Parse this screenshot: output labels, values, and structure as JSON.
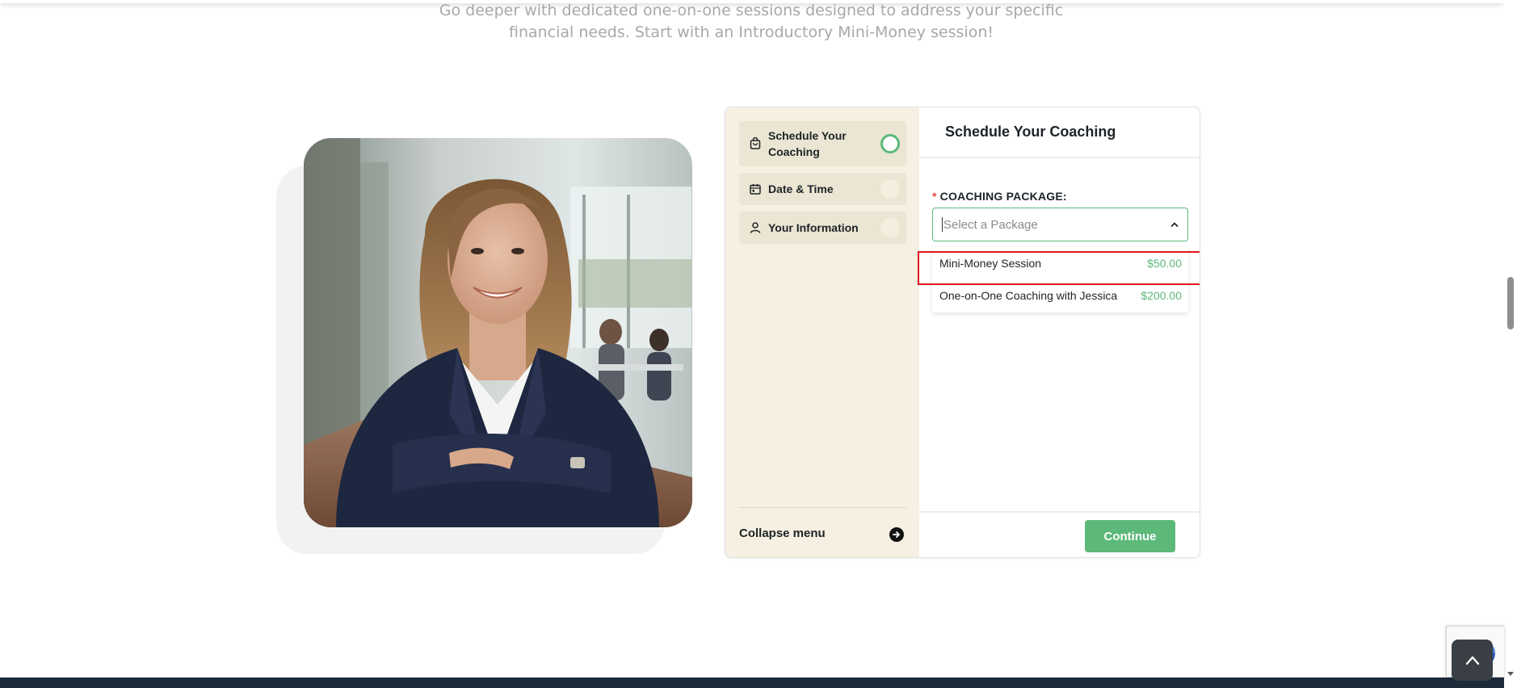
{
  "intro": {
    "line1": "Go deeper with dedicated one-on-one sessions designed to address your specific",
    "line2": "financial needs. Start with an Introductory Mini-Money session!"
  },
  "sidebar": {
    "steps": [
      {
        "label_line1": "Schedule Your",
        "label_line2": "Coaching",
        "icon": "bag-icon",
        "active": true
      },
      {
        "label": "Date & Time",
        "icon": "calendar-icon",
        "active": false
      },
      {
        "label": "Your Information",
        "icon": "user-icon",
        "active": false
      }
    ],
    "collapse_label": "Collapse menu"
  },
  "main": {
    "title": "Schedule Your Coaching",
    "field_label": "COACHING PACKAGE:",
    "required_mark": "*",
    "select_placeholder": "Select a Package",
    "options": [
      {
        "name": "Mini-Money Session",
        "price": "$50.00",
        "highlighted": true
      },
      {
        "name": "One-on-One Coaching with Jessica",
        "price": "$200.00",
        "highlighted": false
      }
    ],
    "continue_label": "Continue"
  },
  "colors": {
    "accent": "#5cb97a",
    "sidebar_bg": "#f5f0e1",
    "highlight": "#e0141e",
    "footer": "#1c2b3a"
  }
}
